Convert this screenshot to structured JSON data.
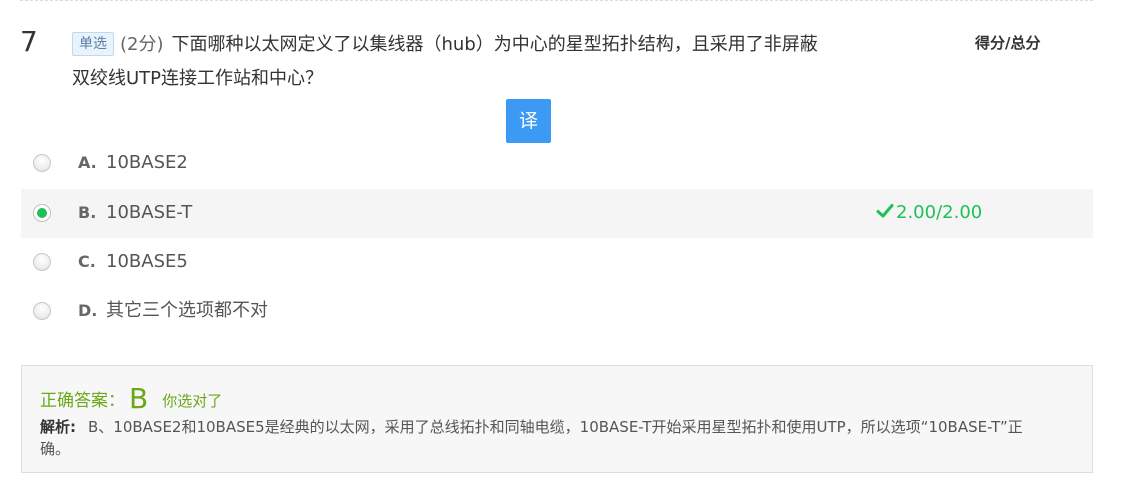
{
  "question": {
    "number": "7",
    "type_badge": "单选",
    "score": "(2分)",
    "text": "下面哪种以太网定义了以集线器（hub）为中心的星型拓扑结构，且采用了非屏蔽双绞线UTP连接工作站和中心？",
    "score_header": "得分/总分",
    "translate_label": "译"
  },
  "options": [
    {
      "letter": "A.",
      "text": "10BASE2",
      "selected": false,
      "score": ""
    },
    {
      "letter": "B.",
      "text": "10BASE-T",
      "selected": true,
      "score": "2.00/2.00"
    },
    {
      "letter": "C.",
      "text": "10BASE5",
      "selected": false,
      "score": ""
    },
    {
      "letter": "D.",
      "text": "其它三个选项都不对",
      "selected": false,
      "score": ""
    }
  ],
  "answer": {
    "label": "正确答案：",
    "letter": "B",
    "feedback": "你选对了",
    "analysis_label": "解析:",
    "analysis_text": "B、10BASE2和10BASE5是经典的以太网，采用了总线拓扑和同轴电缆，10BASE-T开始采用星型拓扑和使用UTP，所以选项“10BASE-T”正确。"
  },
  "colors": {
    "correct_green": "#1fbf5a",
    "answer_green": "#6aa81a",
    "translate_blue": "#3d9af4"
  },
  "icons": {
    "check": "check-icon"
  }
}
